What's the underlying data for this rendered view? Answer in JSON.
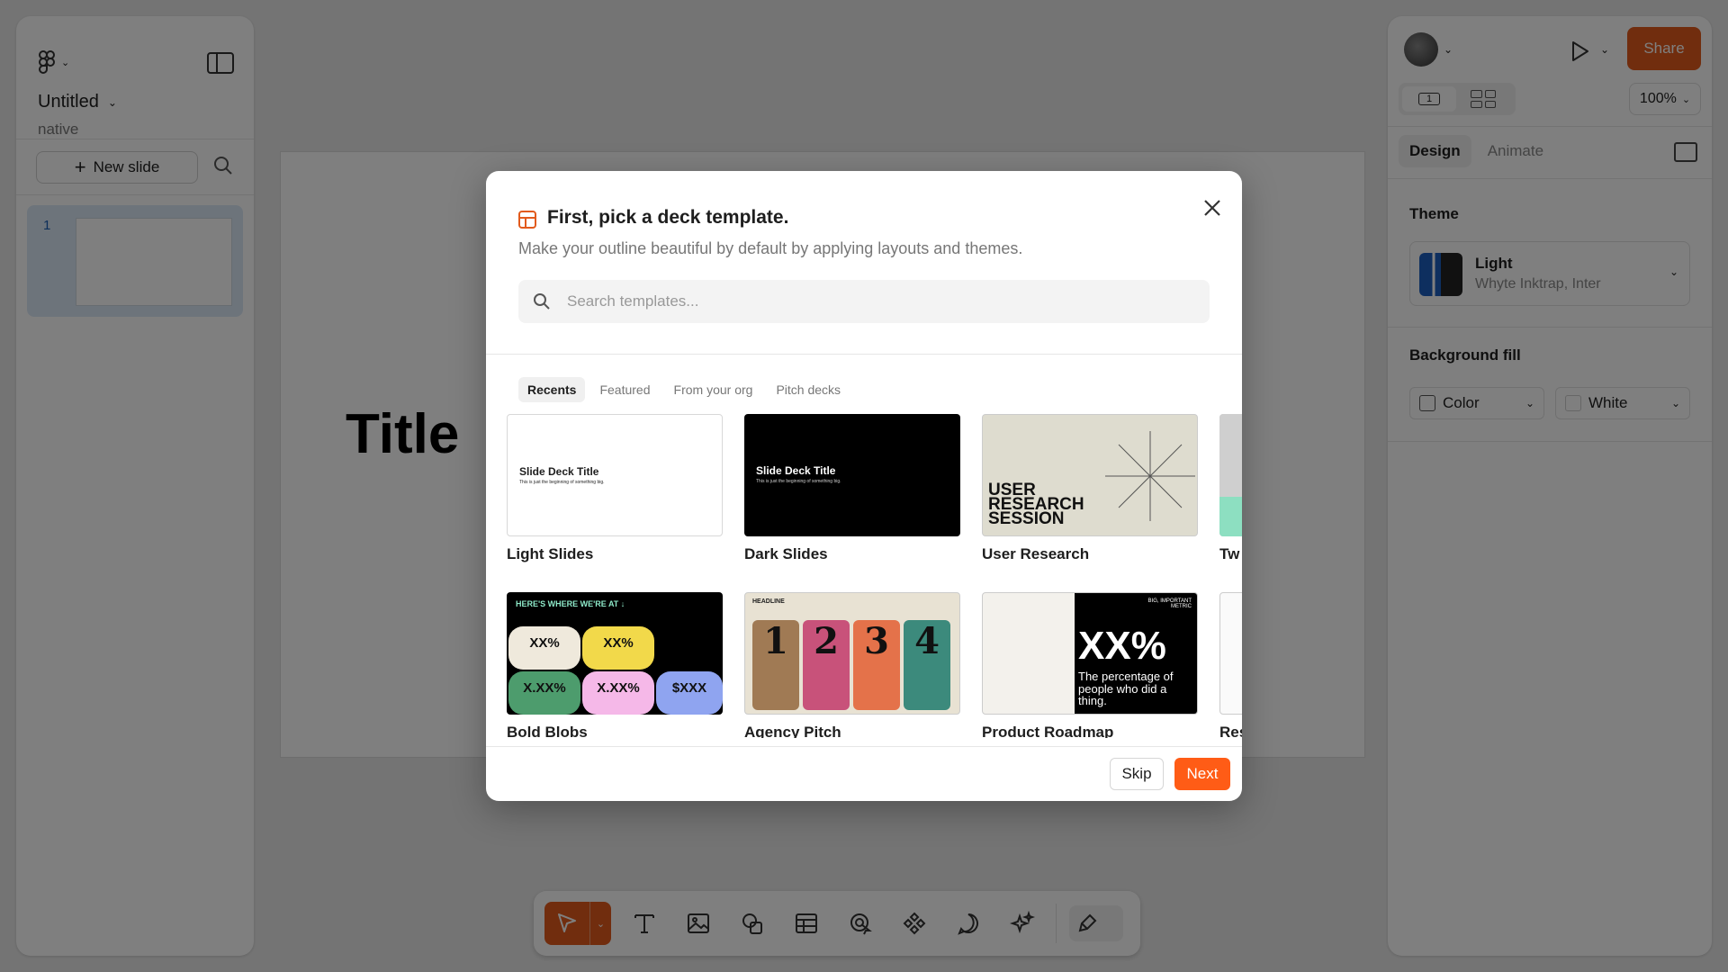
{
  "left_panel": {
    "file_name": "Untitled",
    "file_sub": "native",
    "new_slide_label": "New slide",
    "slide_number": "1"
  },
  "canvas": {
    "slide_title": "Title"
  },
  "right_panel": {
    "share_label": "Share",
    "view_single_label": "1",
    "zoom": "100%",
    "tabs": [
      "Design",
      "Animate"
    ],
    "theme_label": "Theme",
    "theme_name": "Light",
    "theme_fonts": "Whyte Inktrap, Inter",
    "background_fill_label": "Background fill",
    "fill_type": "Color",
    "fill_color": "White"
  },
  "modal": {
    "title": "First, pick a deck template.",
    "description": "Make your outline beautiful by default by applying layouts and themes.",
    "search_placeholder": "Search templates...",
    "tabs": [
      "Recents",
      "Featured",
      "From your org",
      "Pitch decks"
    ],
    "templates": [
      {
        "name": "Light Slides",
        "preview_title": "Slide Deck Title",
        "preview_sub": "This is just the beginning of something big."
      },
      {
        "name": "Dark Slides",
        "preview_title": "Slide Deck Title",
        "preview_sub": "This is just the beginning of something big."
      },
      {
        "name": "User Research",
        "preview_text": "USER RESEARCH SESSION"
      },
      {
        "name": "Tw"
      },
      {
        "name": "Bold Blobs",
        "preview_header": "HERE'S WHERE WE'RE AT ↓",
        "blobs": [
          "XX%",
          "XX%",
          "X.XX%",
          "X.XX%",
          "$XXX"
        ]
      },
      {
        "name": "Agency Pitch",
        "preview_header": "HEADLINE",
        "numbers": [
          "1",
          "2",
          "3",
          "4"
        ]
      },
      {
        "name": "Product Roadmap",
        "preview_metric": "XX%",
        "preview_caption": "The percentage of people who did a thing.",
        "preview_label": "BIG, IMPORTANT METRIC"
      },
      {
        "name": "Res"
      }
    ],
    "skip_label": "Skip",
    "next_label": "Next"
  },
  "colors": {
    "accent": "#ff5c16",
    "share": "#e25a1c"
  }
}
